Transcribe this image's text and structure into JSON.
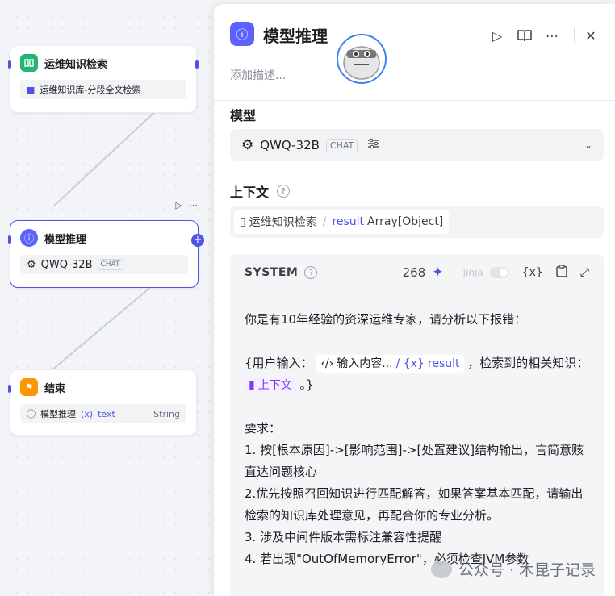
{
  "canvas": {
    "node_knowledge": {
      "title": "运维知识检索",
      "item": "运维知识库-分段全文检索"
    },
    "node_model": {
      "title": "模型推理",
      "model": "QWQ-32B",
      "tag": "CHAT"
    },
    "node_end": {
      "title": "结束",
      "var_source": "模型推理",
      "var_name": "text",
      "var_type": "String"
    }
  },
  "panel": {
    "title": "模型推理",
    "description_placeholder": "添加描述...",
    "model_section": {
      "label": "模型",
      "model_name": "QWQ-32B",
      "model_tag": "CHAT"
    },
    "context_section": {
      "label": "上下文",
      "source": "运维知识检索",
      "field": "result",
      "type": "Array[Object]"
    },
    "system": {
      "title": "SYSTEM",
      "token_count": "268",
      "jinja_label": "Jinja",
      "var_icon": "{x}",
      "line1": "你是有10年经验的资深运维专家，请分析以下报错：",
      "user_prefix": "{用户输入：",
      "chip_input_label": "输入内容...",
      "chip_input_var": "result",
      "user_mid": "，检索到的相关知识：",
      "chip_ctx_label": "上下文",
      "user_suffix": "。}",
      "req_title": "要求：",
      "req1": "1. 按[根本原因]->[影响范围]->[处置建议]结构输出，言简意赅直达问题核心",
      "req2": "2.优先按照召回知识进行匹配解答，如果答案基本匹配，请输出检索的知识库处理意见，再配合你的专业分析。",
      "req3": "3. 涉及中间件版本需标注兼容性提醒",
      "req4": "4. 若出现\"OutOfMemoryError\"，必须检查JVM参数"
    }
  },
  "watermark": "公众号 · 木昆子记录",
  "colors": {
    "accent": "#4d53e8",
    "knowledge_icon": "#22b573",
    "end_icon": "#ff9500"
  }
}
